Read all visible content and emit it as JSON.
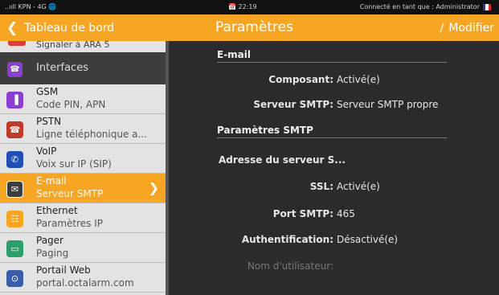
{
  "status_bar": {
    "signal": "..ııll",
    "carrier": "KPN - 4G",
    "network_icon": "globe-icon",
    "time": "22:19",
    "connection": "Connecté en tant que : Administrator",
    "flag_colors": [
      "#1f3c9e",
      "#ffffff",
      "#e02a2a"
    ]
  },
  "nav": {
    "back_label": "Tableau de bord",
    "title": "Paramètres",
    "edit_label": "Modifier",
    "accent": "#f6a623"
  },
  "sidebar": {
    "partial_item": "Signaler à ARA 5",
    "section": {
      "label": "Interfaces",
      "icon": "phone-icon",
      "color": "#8a3fd1"
    },
    "items": [
      {
        "title": "GSM",
        "subtitle": "Code PIN, APN",
        "icon": "signal-icon",
        "color": "#8a3fd1"
      },
      {
        "title": "PSTN",
        "subtitle": "Ligne téléphonique a...",
        "icon": "telephone-icon",
        "color": "#c0392b"
      },
      {
        "title": "VoIP",
        "subtitle": "Voix sur IP (SIP)",
        "icon": "voip-phone-icon",
        "color": "#1f4fb5"
      },
      {
        "title": "E-mail",
        "subtitle": "Serveur SMTP",
        "icon": "envelope-icon",
        "color": "#f6a623",
        "selected": true
      },
      {
        "title": "Ethernet",
        "subtitle": "Paramètres IP",
        "icon": "network-icon",
        "color": "#f6a623"
      },
      {
        "title": "Pager",
        "subtitle": "Paging",
        "icon": "pager-icon",
        "color": "#2aa06a"
      },
      {
        "title": "Portail Web",
        "subtitle": "portal.octalarm.com",
        "icon": "portal-icon",
        "color": "#3a5ea8"
      }
    ]
  },
  "content": {
    "email_section": "E-mail",
    "composant_label": "Composant:",
    "composant_value": "Activé(e)",
    "smtp_server_label": "Serveur SMTP:",
    "smtp_server_value": "Serveur SMTP propre",
    "smtp_section": "Paramètres SMTP",
    "server_address_label": "Adresse du serveur S...",
    "ssl_label": "SSL:",
    "ssl_value": "Activé(e)",
    "port_label": "Port SMTP:",
    "port_value": "465",
    "auth_label": "Authentification:",
    "auth_value": "Désactivé(e)",
    "username_label": "Nom d'utilisateur:"
  }
}
